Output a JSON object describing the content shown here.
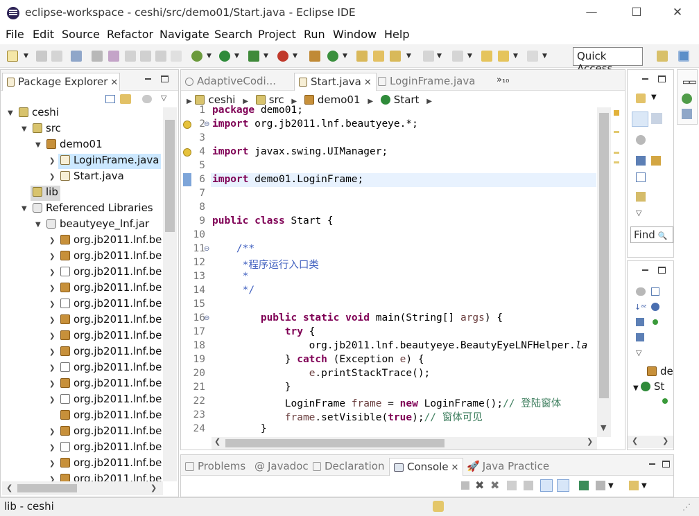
{
  "window": {
    "title": "eclipse-workspace - ceshi/src/demo01/Start.java - Eclipse IDE",
    "controls": {
      "minimize": "—",
      "maximize": "☐",
      "close": "✕"
    }
  },
  "menu": [
    "File",
    "Edit",
    "Source",
    "Refactor",
    "Navigate",
    "Search",
    "Project",
    "Run",
    "Window",
    "Help"
  ],
  "toolbar": {
    "quick_access": "Quick Access"
  },
  "package_explorer": {
    "tab_label": "Package Explorer",
    "tree": [
      {
        "label": "ceshi",
        "depth": 0,
        "expanded": true,
        "icon": "project"
      },
      {
        "label": "src",
        "depth": 1,
        "expanded": true,
        "icon": "source-folder"
      },
      {
        "label": "demo01",
        "depth": 2,
        "expanded": true,
        "icon": "package"
      },
      {
        "label": "LoginFrame.java",
        "depth": 3,
        "expanded": false,
        "icon": "java-file",
        "selected": true
      },
      {
        "label": "Start.java",
        "depth": 3,
        "expanded": false,
        "icon": "java-file"
      },
      {
        "label": "lib",
        "depth": 1,
        "expanded": null,
        "icon": "folder",
        "highlighted": true
      },
      {
        "label": "Referenced Libraries",
        "depth": 1,
        "expanded": true,
        "icon": "library"
      },
      {
        "label": "beautyeye_lnf.jar",
        "depth": 2,
        "expanded": true,
        "icon": "jar"
      },
      {
        "label": "org.jb2011.lnf.be",
        "depth": 3,
        "expanded": false,
        "icon": "package"
      },
      {
        "label": "org.jb2011.lnf.be",
        "depth": 3,
        "expanded": false,
        "icon": "package"
      },
      {
        "label": "org.jb2011.lnf.be",
        "depth": 3,
        "expanded": false,
        "icon": "package-empty"
      },
      {
        "label": "org.jb2011.lnf.be",
        "depth": 3,
        "expanded": false,
        "icon": "package"
      },
      {
        "label": "org.jb2011.lnf.be",
        "depth": 3,
        "expanded": false,
        "icon": "package-empty"
      },
      {
        "label": "org.jb2011.lnf.be",
        "depth": 3,
        "expanded": false,
        "icon": "package"
      },
      {
        "label": "org.jb2011.lnf.be",
        "depth": 3,
        "expanded": false,
        "icon": "package"
      },
      {
        "label": "org.jb2011.lnf.be",
        "depth": 3,
        "expanded": false,
        "icon": "package"
      },
      {
        "label": "org.jb2011.lnf.be",
        "depth": 3,
        "expanded": false,
        "icon": "package-empty"
      },
      {
        "label": "org.jb2011.lnf.be",
        "depth": 3,
        "expanded": false,
        "icon": "package"
      },
      {
        "label": "org.jb2011.lnf.be",
        "depth": 3,
        "expanded": false,
        "icon": "package-empty"
      },
      {
        "label": "org.jb2011.lnf.be",
        "depth": 3,
        "expanded": null,
        "icon": "package"
      },
      {
        "label": "org.jb2011.lnf.be",
        "depth": 3,
        "expanded": false,
        "icon": "package"
      },
      {
        "label": "org.jb2011.lnf.be",
        "depth": 3,
        "expanded": false,
        "icon": "package-empty"
      },
      {
        "label": "org.jb2011.lnf.be",
        "depth": 3,
        "expanded": false,
        "icon": "package"
      },
      {
        "label": "org.jb2011.lnf.be",
        "depth": 3,
        "expanded": false,
        "icon": "package"
      }
    ]
  },
  "editor": {
    "tabs": [
      {
        "label": "AdaptiveCodi...",
        "active": false
      },
      {
        "label": "Start.java",
        "active": true
      },
      {
        "label": "LoginFrame.java",
        "active": false
      }
    ],
    "overflow_label": "»₁₀",
    "breadcrumb": [
      "ceshi",
      "src",
      "demo01",
      "Start"
    ],
    "lines": [
      {
        "n": "1",
        "html": "<span class='kw'>package</span> demo01;"
      },
      {
        "n": "2",
        "html": "<span class='kw'>import</span> org.jb2011.lnf.beautyeye.*;"
      },
      {
        "n": "3",
        "html": ""
      },
      {
        "n": "4",
        "html": "<span class='kw'>import</span> javax.swing.UIManager;"
      },
      {
        "n": "5",
        "html": ""
      },
      {
        "n": "6",
        "html": "<span class='kw'>import</span> demo01.LoginFrame;"
      },
      {
        "n": "7",
        "html": ""
      },
      {
        "n": "8",
        "html": ""
      },
      {
        "n": "9",
        "html": "<span class='kw'>public</span> <span class='kw'>class</span> Start {"
      },
      {
        "n": "10",
        "html": ""
      },
      {
        "n": "11",
        "html": "    <span class='cm'>/**</span>"
      },
      {
        "n": "12",
        "html": "<span class='cm'>     *程序运行入口类</span>"
      },
      {
        "n": "13",
        "html": "<span class='cm'>     *</span>"
      },
      {
        "n": "14",
        "html": "<span class='cm'>     */</span>"
      },
      {
        "n": "15",
        "html": ""
      },
      {
        "n": "16",
        "html": "        <span class='kw'>public</span> <span class='kw'>static</span> <span class='kw'>void</span> main(String[] <span class='vr'>args</span>) {"
      },
      {
        "n": "17",
        "html": "            <span class='kw'>try</span> {"
      },
      {
        "n": "18",
        "html": "                org.jb2011.lnf.beautyeye.BeautyEyeLNFHelper.<span class='it'>la</span>"
      },
      {
        "n": "19",
        "html": "            } <span class='kw'>catch</span> (Exception <span class='vr'>e</span>) {"
      },
      {
        "n": "20",
        "html": "                <span class='vr'>e</span>.printStackTrace();"
      },
      {
        "n": "21",
        "html": "            }"
      },
      {
        "n": "22",
        "html": "            LoginFrame <span class='vr'>frame</span> = <span class='kw'>new</span> LoginFrame();<span class='cm2'>// 登陆窗体</span>"
      },
      {
        "n": "23",
        "html": "            <span class='vr'>frame</span>.setVisible(<span class='kw'>true</span>);<span class='cm2'>// 窗体可见</span>"
      },
      {
        "n": "24",
        "html": "        }"
      }
    ]
  },
  "right_panel": {
    "find_label": "Find",
    "tree_labels": [
      "de",
      "St"
    ]
  },
  "bottom": {
    "tabs": [
      {
        "label": "Problems",
        "active": false
      },
      {
        "label": "Javadoc",
        "active": false
      },
      {
        "label": "Declaration",
        "active": false
      },
      {
        "label": "Console",
        "active": true
      },
      {
        "label": "Java Practice",
        "active": false
      }
    ]
  },
  "status": {
    "text": "lib - ceshi"
  },
  "colors": {
    "keyword": "#7f0055",
    "comment": "#3f5fbf",
    "line_comment": "#3f7f5f",
    "selection": "#cce8ff"
  }
}
